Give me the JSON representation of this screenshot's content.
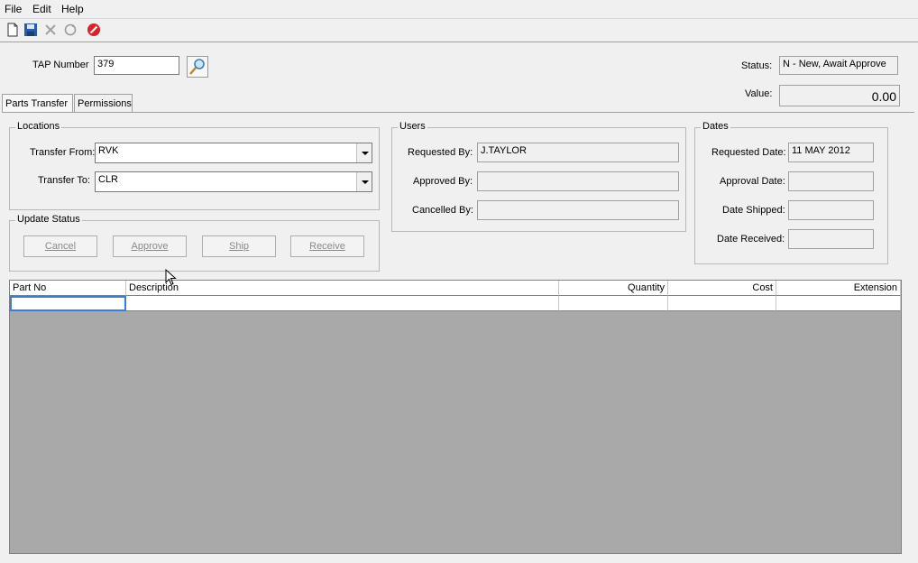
{
  "menu": {
    "file": "File",
    "edit": "Edit",
    "help": "Help"
  },
  "toolbar": {
    "icons": [
      "new-document-icon",
      "save-icon",
      "delete-icon",
      "refresh-icon",
      "stop-icon"
    ]
  },
  "header": {
    "tap_number_label": "TAP Number",
    "tap_number_value": "379",
    "status_label": "Status:",
    "status_value": "N - New, Await Approve",
    "value_label": "Value:",
    "value_value": "0.00"
  },
  "tabs": [
    "Parts Transfer",
    "Permissions"
  ],
  "locations": {
    "title": "Locations",
    "from_label": "Transfer From:",
    "from_value": "RVK",
    "to_label": "Transfer To:",
    "to_value": "CLR"
  },
  "update_status": {
    "title": "Update Status",
    "cancel": "Cancel",
    "approve": "Approve",
    "ship": "Ship",
    "receive": "Receive"
  },
  "users": {
    "title": "Users",
    "requested_label": "Requested By:",
    "requested_value": "J.TAYLOR",
    "approved_label": "Approved By:",
    "approved_value": "",
    "cancelled_label": "Cancelled By:",
    "cancelled_value": ""
  },
  "dates": {
    "title": "Dates",
    "requested_label": "Requested Date:",
    "requested_value": "11 MAY 2012",
    "approval_label": "Approval Date:",
    "approval_value": "",
    "shipped_label": "Date Shipped:",
    "shipped_value": "",
    "received_label": "Date Received:",
    "received_value": ""
  },
  "grid": {
    "columns": [
      "Part No",
      "Description",
      "Quantity",
      "Cost",
      "Extension"
    ]
  }
}
